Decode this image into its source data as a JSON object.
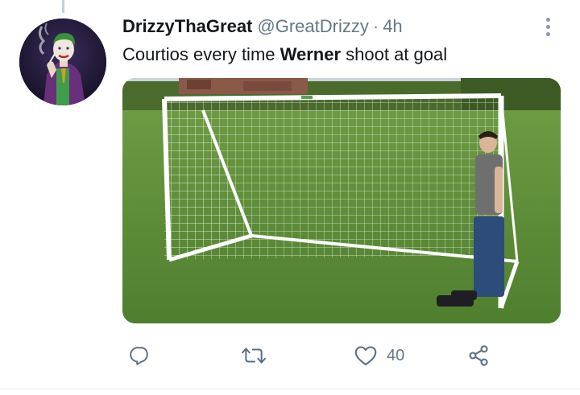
{
  "tweet": {
    "display_name": "DrizzyThaGreat",
    "handle": "@GreatDrizzy",
    "separator": "·",
    "time": "4h",
    "text_before": "Courtios every time ",
    "text_bold": "Werner",
    "text_after": " shoot at goal"
  },
  "media": {
    "alt": "photo"
  },
  "actions": {
    "reply_icon": "reply-icon",
    "retweet_icon": "retweet-icon",
    "like_icon": "heart-icon",
    "like_count": "40",
    "share_icon": "share-icon"
  },
  "colors": {
    "text": "#14171a",
    "secondary": "#657786",
    "icon": "#5b7083",
    "divider": "#e6ecf0"
  }
}
